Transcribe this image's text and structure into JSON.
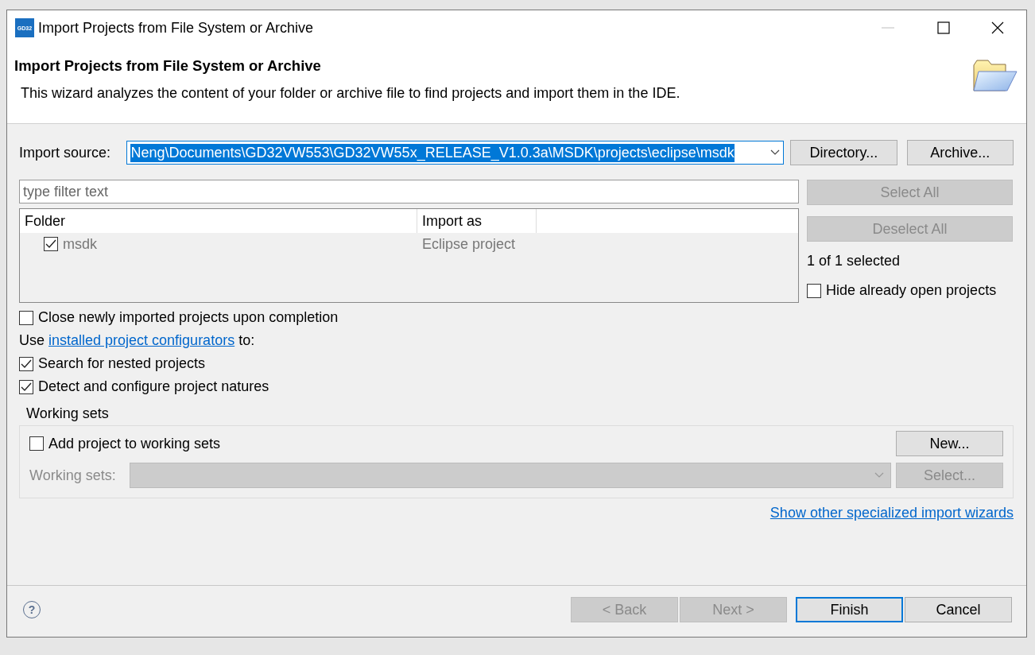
{
  "window": {
    "app_icon_text": "GD32",
    "title": "Import Projects from File System or Archive",
    "minimize_disabled": true
  },
  "header": {
    "title": "Import Projects from File System or Archive",
    "description": "This wizard analyzes the content of your folder or archive file to find projects and import them in the IDE."
  },
  "import_source": {
    "label": "Import source:",
    "value": "Neng\\Documents\\GD32VW553\\GD32VW55x_RELEASE_V1.0.3a\\MSDK\\projects\\eclipse\\msdk",
    "text_selected": true,
    "buttons": [
      {
        "label": "Directory...",
        "disabled": false
      },
      {
        "label": "Archive...",
        "disabled": false
      }
    ]
  },
  "filter": {
    "placeholder": "type filter text"
  },
  "table": {
    "columns": [
      "Folder",
      "Import as"
    ],
    "rows": [
      {
        "folder": "msdk",
        "import_as": "Eclipse project",
        "checked": true
      }
    ]
  },
  "side_buttons": [
    {
      "label": "Select All",
      "disabled": true
    },
    {
      "label": "Deselect All",
      "disabled": true
    }
  ],
  "selection_count": "1 of 1 selected",
  "hide_open": {
    "label": "Hide already open projects",
    "checked": false
  },
  "close_option": {
    "label": "Close newly imported projects upon completion",
    "checked": false
  },
  "configurators": {
    "prefix": "Use",
    "link": "installed project configurators",
    "suffix": "to:"
  },
  "options": [
    {
      "label": "Search for nested projects",
      "checked": true
    },
    {
      "label": "Detect and configure project natures",
      "checked": true
    }
  ],
  "working_sets": {
    "title": "Working sets",
    "add": {
      "label": "Add project to working sets",
      "checked": false
    },
    "new_button": {
      "label": "New...",
      "disabled": false
    },
    "sets_label": "Working sets:",
    "sets_disabled": true,
    "select_button": {
      "label": "Select...",
      "disabled": true
    }
  },
  "other_wizards_link": "Show other specialized import wizards",
  "footer": {
    "help": "?",
    "buttons": [
      {
        "label": "< Back",
        "disabled": true,
        "default": false
      },
      {
        "label": "Next >",
        "disabled": true,
        "default": false
      },
      {
        "label": "Finish",
        "disabled": false,
        "default": true
      },
      {
        "label": "Cancel",
        "disabled": false,
        "default": false
      }
    ]
  }
}
